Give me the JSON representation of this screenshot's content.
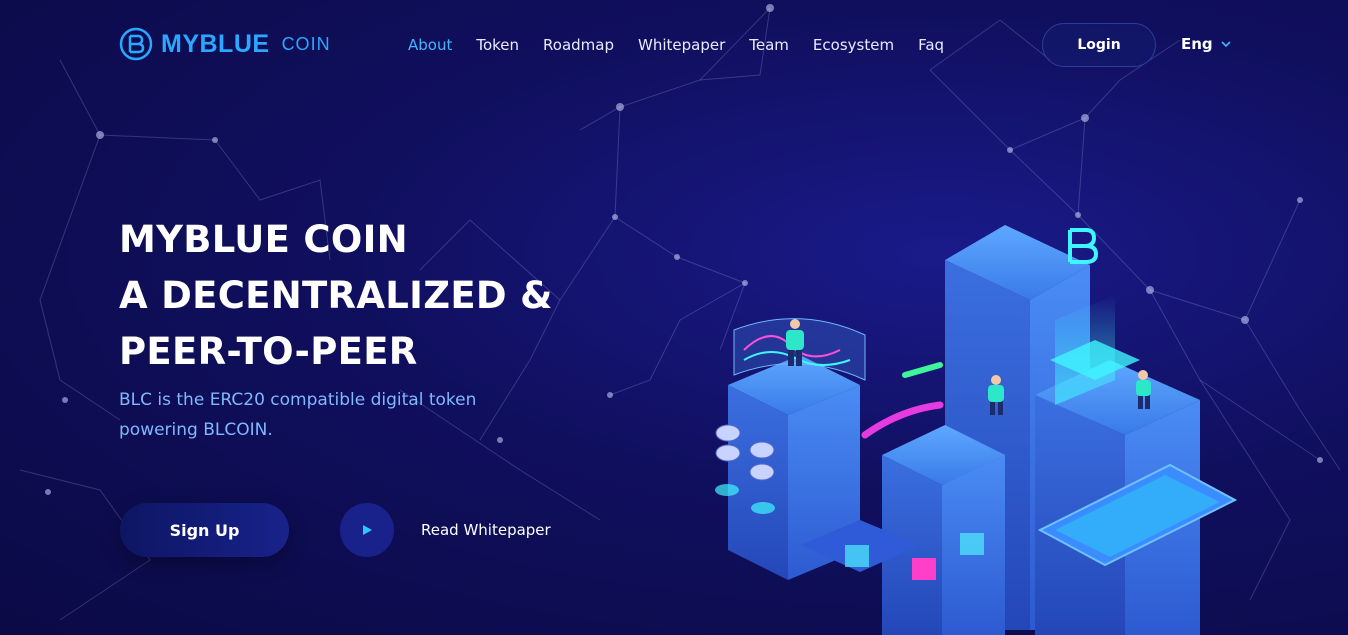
{
  "brand": {
    "name": "MYBLUE",
    "suffix": "COIN"
  },
  "nav": {
    "items": [
      {
        "label": "About",
        "active": true
      },
      {
        "label": "Token",
        "active": false
      },
      {
        "label": "Roadmap",
        "active": false
      },
      {
        "label": "Whitepaper",
        "active": false
      },
      {
        "label": "Team",
        "active": false
      },
      {
        "label": "Ecosystem",
        "active": false
      },
      {
        "label": "Faq",
        "active": false
      }
    ],
    "login_label": "Login",
    "language": "Eng"
  },
  "hero": {
    "title_lines": [
      "MYBLUE COIN",
      "A DECENTRALIZED &",
      "PEER-TO-PEER"
    ],
    "subtitle": "BLC is the ERC20 compatible digital token powering BLCOIN.",
    "signup_label": "Sign Up",
    "whitepaper_label": "Read Whitepaper"
  },
  "colors": {
    "accent": "#2aa7ff",
    "background": "#100f5e",
    "subtitle": "#7fb8ff"
  },
  "icons": [
    "logo-icon",
    "chevron-down-icon",
    "play-icon"
  ]
}
